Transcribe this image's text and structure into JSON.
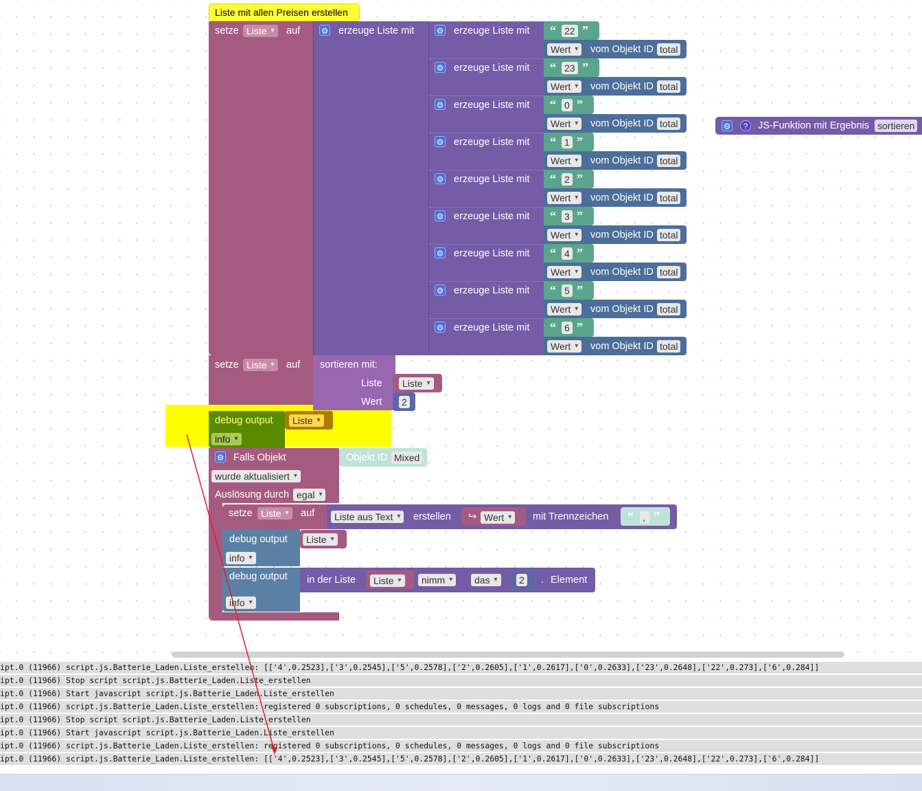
{
  "comment_note": "Liste mit allen Preisen erstellen",
  "set1": {
    "setze": "setze",
    "var": "Liste",
    "auf": "auf",
    "create": "erzeuge Liste mit"
  },
  "rows": [
    {
      "label": "erzeuge Liste mit",
      "num": "22",
      "wert": "Wert",
      "vom": "vom Objekt ID",
      "obj": "total"
    },
    {
      "label": "erzeuge Liste mit",
      "num": "23",
      "wert": "Wert",
      "vom": "vom Objekt ID",
      "obj": "total"
    },
    {
      "label": "erzeuge Liste mit",
      "num": "0",
      "wert": "Wert",
      "vom": "vom Objekt ID",
      "obj": "total"
    },
    {
      "label": "erzeuge Liste mit",
      "num": "1",
      "wert": "Wert",
      "vom": "vom Objekt ID",
      "obj": "total"
    },
    {
      "label": "erzeuge Liste mit",
      "num": "2",
      "wert": "Wert",
      "vom": "vom Objekt ID",
      "obj": "total"
    },
    {
      "label": "erzeuge Liste mit",
      "num": "3",
      "wert": "Wert",
      "vom": "vom Objekt ID",
      "obj": "total"
    },
    {
      "label": "erzeuge Liste mit",
      "num": "4",
      "wert": "Wert",
      "vom": "vom Objekt ID",
      "obj": "total"
    },
    {
      "label": "erzeuge Liste mit",
      "num": "5",
      "wert": "Wert",
      "vom": "vom Objekt ID",
      "obj": "total"
    },
    {
      "label": "erzeuge Liste mit",
      "num": "6",
      "wert": "Wert",
      "vom": "vom Objekt ID",
      "obj": "total"
    }
  ],
  "jsfunc": {
    "label": "JS-Funktion mit Ergebnis",
    "name": "sortieren",
    "help": "?"
  },
  "set2": {
    "setze": "setze",
    "var": "Liste",
    "auf": "auf",
    "sort": "sortieren  mit:",
    "liste_label": "Liste",
    "liste_var": "Liste",
    "wert_label": "Wert",
    "wert_num": "2"
  },
  "debug1": {
    "label": "debug output",
    "var": "Liste",
    "level": "info"
  },
  "trigger": {
    "falls": "Falls Objekt",
    "objid_label": "Objekt ID",
    "objid_val": "Mixed",
    "update": "wurde aktualisiert",
    "ausloesung": "Auslösung durch",
    "ausloesung_val": "egal"
  },
  "set3": {
    "setze": "setze",
    "var": "Liste",
    "auf": "auf",
    "from_text": "Liste aus Text",
    "erstellen": "erstellen",
    "wert": "Wert",
    "trenn": "mit Trennzeichen",
    "sep": ","
  },
  "debug2": {
    "label": "debug output",
    "var": "Liste",
    "level": "info"
  },
  "debug3": {
    "label": "debug output",
    "level": "info",
    "in_list": "in der Liste",
    "var": "Liste",
    "nimm": "nimm",
    "das": "das",
    "num": "2",
    "dot": ".",
    "element": "Element"
  },
  "logs": [
    "ipt.0 (11966) script.js.Batterie_Laden.Liste_erstellen: [['4',0.2523],['3',0.2545],['5',0.2578],['2',0.2605],['1',0.2617],['0',0.2633],['23',0.2648],['22',0.273],['6',0.284]]",
    "ipt.0 (11966) Stop script script.js.Batterie_Laden.Liste_erstellen",
    "ipt.0 (11966) Start javascript script.js.Batterie_Laden.Liste_erstellen",
    "ipt.0 (11966) script.js.Batterie_Laden.Liste_erstellen: registered 0 subscriptions, 0 schedules, 0 messages, 0 logs and 0 file subscriptions",
    "ipt.0 (11966) Stop script script.js.Batterie_Laden.Liste_erstellen",
    "ipt.0 (11966) Start javascript script.js.Batterie_Laden.Liste_erstellen",
    "ipt.0 (11966) script.js.Batterie_Laden.Liste_erstellen: registered 0 subscriptions, 0 schedules, 0 messages, 0 logs and 0 file subscriptions",
    "ipt.0 (11966) script.js.Batterie_Laden.Liste_erstellen: [['4',0.2523],['3',0.2545],['5',0.2578],['2',0.2605],['1',0.2617],['0',0.2633],['23',0.2648],['22',0.273],['6',0.284]]"
  ],
  "colors": {
    "variable": "#a55b80",
    "list": "#745ca6",
    "text": "#5ba58c",
    "object": "#4c6e9a",
    "debug": "#5b80a5",
    "debug_hl": "#5a8a00",
    "highlight": "#ffff00",
    "arrow": "#e02020"
  }
}
